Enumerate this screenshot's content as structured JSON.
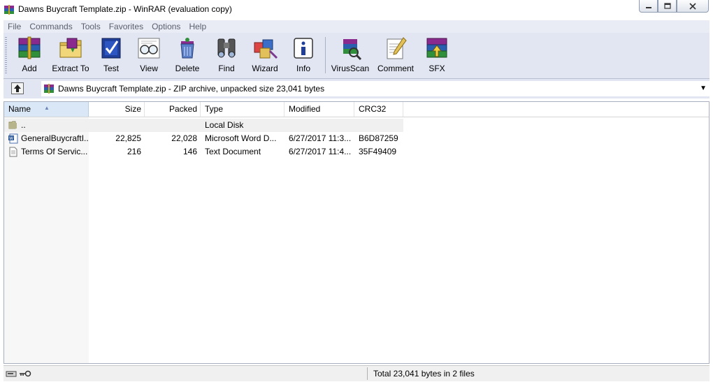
{
  "window": {
    "title": "Dawns Buycraft Template.zip - WinRAR (evaluation copy)"
  },
  "menu": [
    "File",
    "Commands",
    "Tools",
    "Favorites",
    "Options",
    "Help"
  ],
  "toolbar": {
    "add": "Add",
    "extract": "Extract To",
    "test": "Test",
    "view": "View",
    "delete": "Delete",
    "find": "Find",
    "wizard": "Wizard",
    "info": "Info",
    "virusscan": "VirusScan",
    "comment": "Comment",
    "sfx": "SFX"
  },
  "address": {
    "text": "Dawns Buycraft Template.zip - ZIP archive, unpacked size 23,041 bytes"
  },
  "columns": {
    "name": "Name",
    "size": "Size",
    "packed": "Packed",
    "type": "Type",
    "modified": "Modified",
    "crc": "CRC32"
  },
  "rows": [
    {
      "name": "..",
      "size": "",
      "packed": "",
      "type": "Local Disk",
      "modified": "",
      "crc": ""
    },
    {
      "name": "GeneralBuycraftI...",
      "size": "22,825",
      "packed": "22,028",
      "type": "Microsoft Word D...",
      "modified": "6/27/2017 11:3...",
      "crc": "B6D87259"
    },
    {
      "name": "Terms Of Servic...",
      "size": "216",
      "packed": "146",
      "type": "Text Document",
      "modified": "6/27/2017 11:4...",
      "crc": "35F49409"
    }
  ],
  "status": {
    "text": "Total 23,041 bytes in 2 files"
  },
  "icons": {
    "app": "winrar-books-icon",
    "up": "up-folder-icon",
    "folder": "folder-icon",
    "word": "word-document-icon",
    "text": "text-document-icon",
    "disk": "disk-icon",
    "key": "key-icon"
  }
}
